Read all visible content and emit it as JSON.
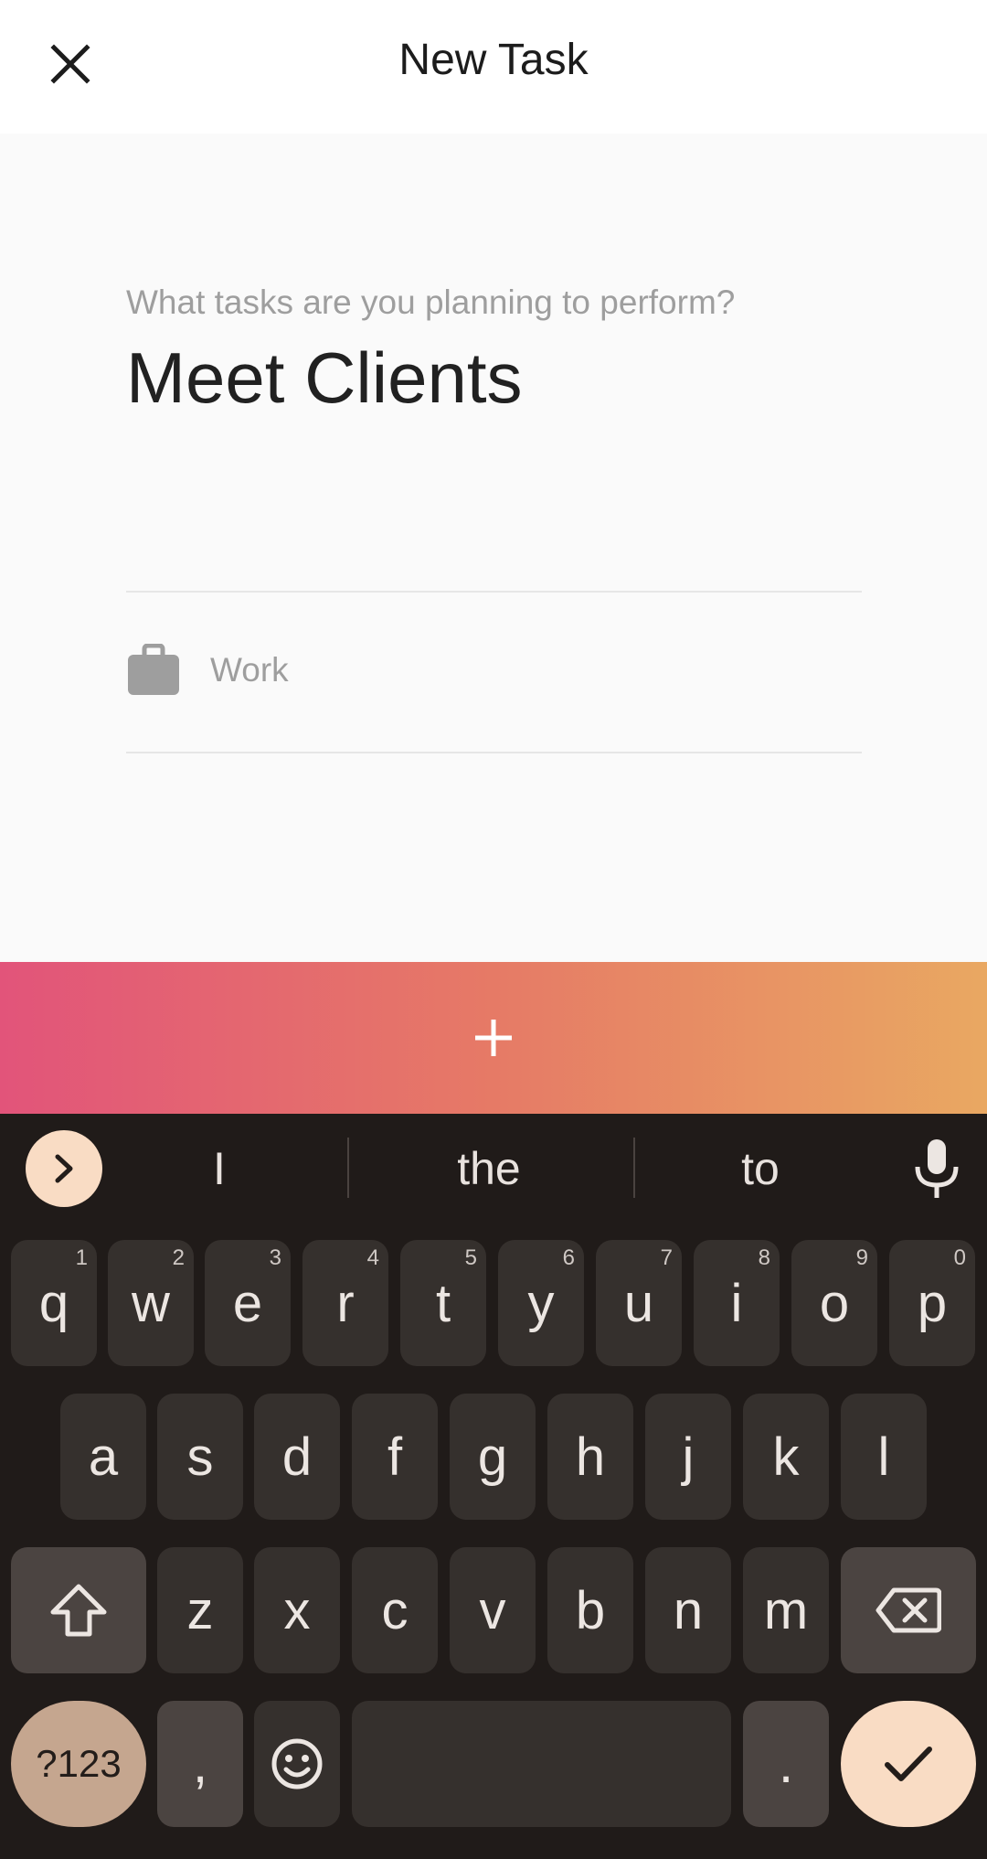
{
  "app_bar": {
    "title": "New Task"
  },
  "form": {
    "prompt": "What tasks are you planning to perform?",
    "task_value": "Meet Clients",
    "category": "Work"
  },
  "add_bar": {
    "label": "+"
  },
  "keyboard": {
    "suggestions": [
      "I",
      "the",
      "to"
    ],
    "row1": [
      {
        "key": "q",
        "num": "1"
      },
      {
        "key": "w",
        "num": "2"
      },
      {
        "key": "e",
        "num": "3"
      },
      {
        "key": "r",
        "num": "4"
      },
      {
        "key": "t",
        "num": "5"
      },
      {
        "key": "y",
        "num": "6"
      },
      {
        "key": "u",
        "num": "7"
      },
      {
        "key": "i",
        "num": "8"
      },
      {
        "key": "o",
        "num": "9"
      },
      {
        "key": "p",
        "num": "0"
      }
    ],
    "row2": [
      "a",
      "s",
      "d",
      "f",
      "g",
      "h",
      "j",
      "k",
      "l"
    ],
    "row3": [
      "z",
      "x",
      "c",
      "v",
      "b",
      "n",
      "m"
    ],
    "symbols_label": "?123",
    "comma": ",",
    "period": "."
  },
  "colors": {
    "accent_start": "#e2547a",
    "accent_end": "#e9a862",
    "keyboard_bg": "#201b19",
    "key_bg": "#35302d",
    "action_peach": "#f9dcc4"
  }
}
